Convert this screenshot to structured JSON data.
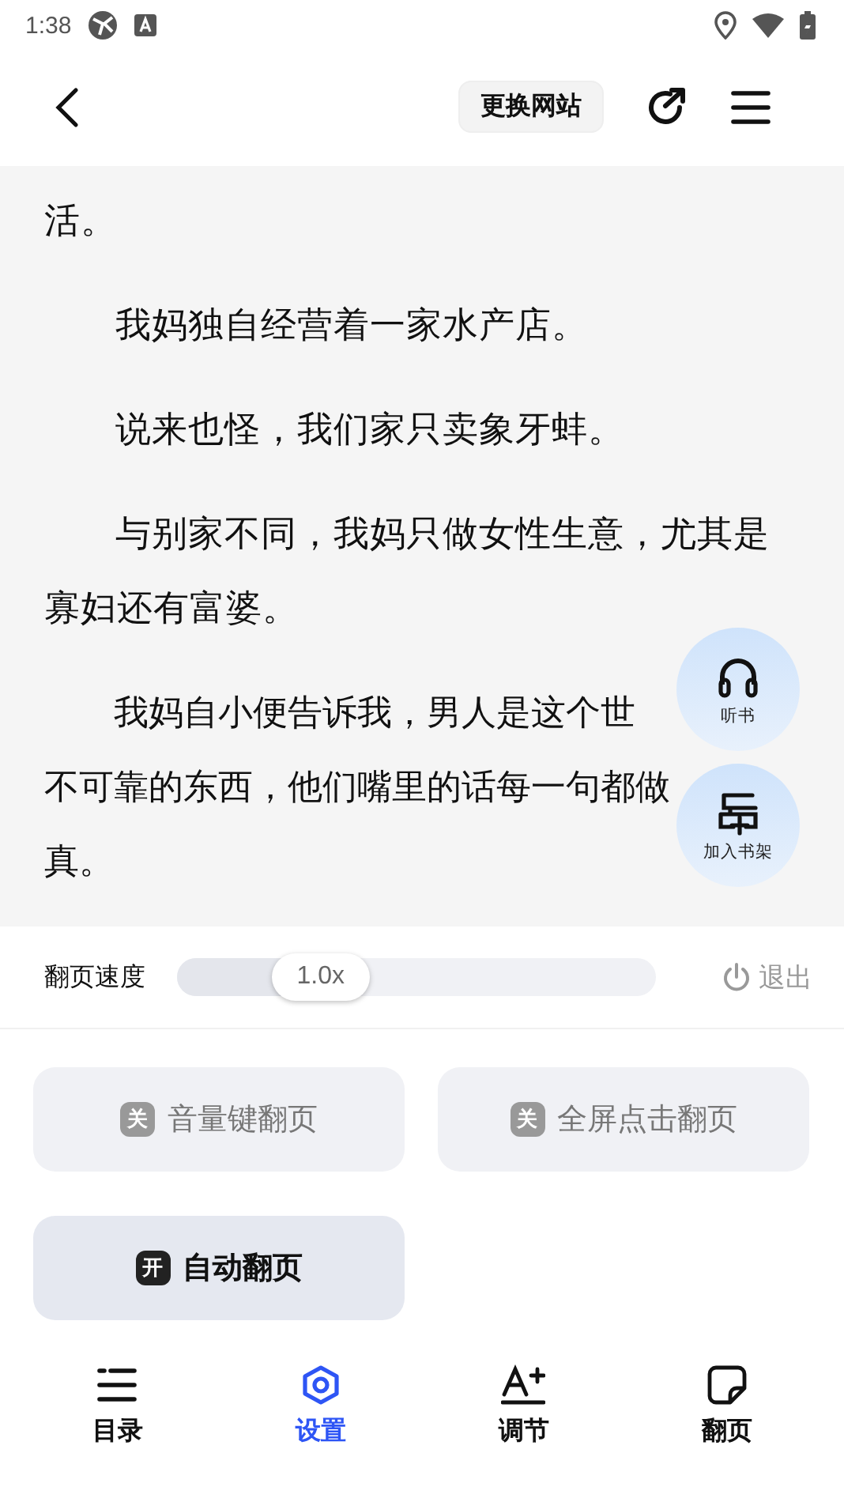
{
  "status_bar": {
    "time": "1:38"
  },
  "toolbar": {
    "change_site": "更换网站"
  },
  "paragraphs": [
    {
      "indent": false,
      "lines": [
        "活。"
      ]
    },
    {
      "indent": true,
      "lines": [
        "我妈独自经营着一家水产店。"
      ]
    },
    {
      "indent": true,
      "lines": [
        "说来也怪，我们家只卖象牙蚌。"
      ]
    },
    {
      "indent": true,
      "lines": [
        "与别家不同，我妈只做女性生意，尤其是寡妇还有富婆。"
      ]
    },
    {
      "indent": true,
      "lines": [
        "我妈自小便告诉我，男人是这个世",
        "不可靠的东西，他们嘴里的话每一句都做",
        "真。"
      ]
    }
  ],
  "floating_buttons": [
    {
      "kind": "listen",
      "label": "听书"
    },
    {
      "kind": "shelf",
      "label": "加入书架"
    }
  ],
  "speed": {
    "label": "翻页速度",
    "value": "1.0x",
    "level": 0.3,
    "exit": "退出"
  },
  "toggles": [
    {
      "badge": "关",
      "label": "音量键翻页",
      "on": false
    },
    {
      "badge": "关",
      "label": "全屏点击翻页",
      "on": false
    },
    {
      "badge": "开",
      "label": "自动翻页",
      "on": true
    }
  ],
  "tabs": [
    {
      "kind": "contents",
      "label": "目录",
      "selected": false
    },
    {
      "kind": "settings",
      "label": "设置",
      "selected": true
    },
    {
      "kind": "adjust",
      "label": "调节",
      "selected": false
    },
    {
      "kind": "page",
      "label": "翻页",
      "selected": false
    }
  ]
}
